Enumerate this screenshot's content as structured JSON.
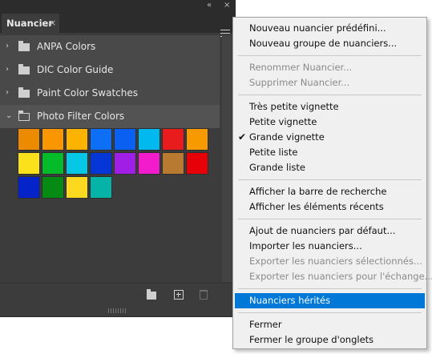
{
  "panel": {
    "tab_label": "Nuancier",
    "tab_close": "×",
    "collapse_glyph": "«",
    "close_glyph": "×",
    "groups": [
      {
        "label": "ANPA Colors",
        "expanded": false
      },
      {
        "label": "DIC Color Guide",
        "expanded": false
      },
      {
        "label": "Paint Color Swatches",
        "expanded": false
      },
      {
        "label": "Photo Filter Colors",
        "expanded": true
      }
    ],
    "swatches": [
      [
        "#ec8a00",
        "#fa9600",
        "#fdb300",
        "#0d6ff5",
        "#0a60f0",
        "#01b9ee",
        "#e81c1c",
        "#f79a00"
      ],
      [
        "#fbe01c",
        "#05bb2a",
        "#06c7e6",
        "#0537d8",
        "#a11ee6",
        "#f21ccd",
        "#b87a31",
        "#e80009"
      ],
      [
        "#0423c8",
        "#058a14",
        "#fcd81e",
        "#05b3a7"
      ]
    ],
    "bottom_icons": [
      "new-group-icon",
      "new-swatch-icon",
      "delete-icon"
    ]
  },
  "menu": {
    "items": [
      {
        "label": "Nouveau nuancier prédéfini...",
        "enabled": true
      },
      {
        "label": "Nouveau groupe de nuanciers...",
        "enabled": true
      },
      {
        "separator": true
      },
      {
        "label": "Renommer Nuancier...",
        "enabled": false
      },
      {
        "label": "Supprimer Nuancier...",
        "enabled": false
      },
      {
        "separator": true
      },
      {
        "label": "Très petite vignette",
        "enabled": true
      },
      {
        "label": "Petite vignette",
        "enabled": true
      },
      {
        "label": "Grande vignette",
        "enabled": true,
        "checked": true
      },
      {
        "label": "Petite liste",
        "enabled": true
      },
      {
        "label": "Grande liste",
        "enabled": true
      },
      {
        "separator": true
      },
      {
        "label": "Afficher la barre de recherche",
        "enabled": true
      },
      {
        "label": "Afficher les éléments récents",
        "enabled": true
      },
      {
        "separator": true
      },
      {
        "label": "Ajout de nuanciers par défaut...",
        "enabled": true
      },
      {
        "label": "Importer les nuanciers...",
        "enabled": true
      },
      {
        "label": "Exporter les nuanciers sélectionnés...",
        "enabled": false
      },
      {
        "label": "Exporter les nuanciers pour l'échange...",
        "enabled": false
      },
      {
        "separator": true
      },
      {
        "label": "Nuanciers hérités",
        "enabled": true,
        "highlighted": true
      },
      {
        "separator": true
      },
      {
        "label": "Fermer",
        "enabled": true
      },
      {
        "label": "Fermer le groupe d'onglets",
        "enabled": true
      }
    ],
    "check_glyph": "✔"
  },
  "colors": {
    "highlight": "#0078d7",
    "panel_bg": "#3c3c3c"
  }
}
